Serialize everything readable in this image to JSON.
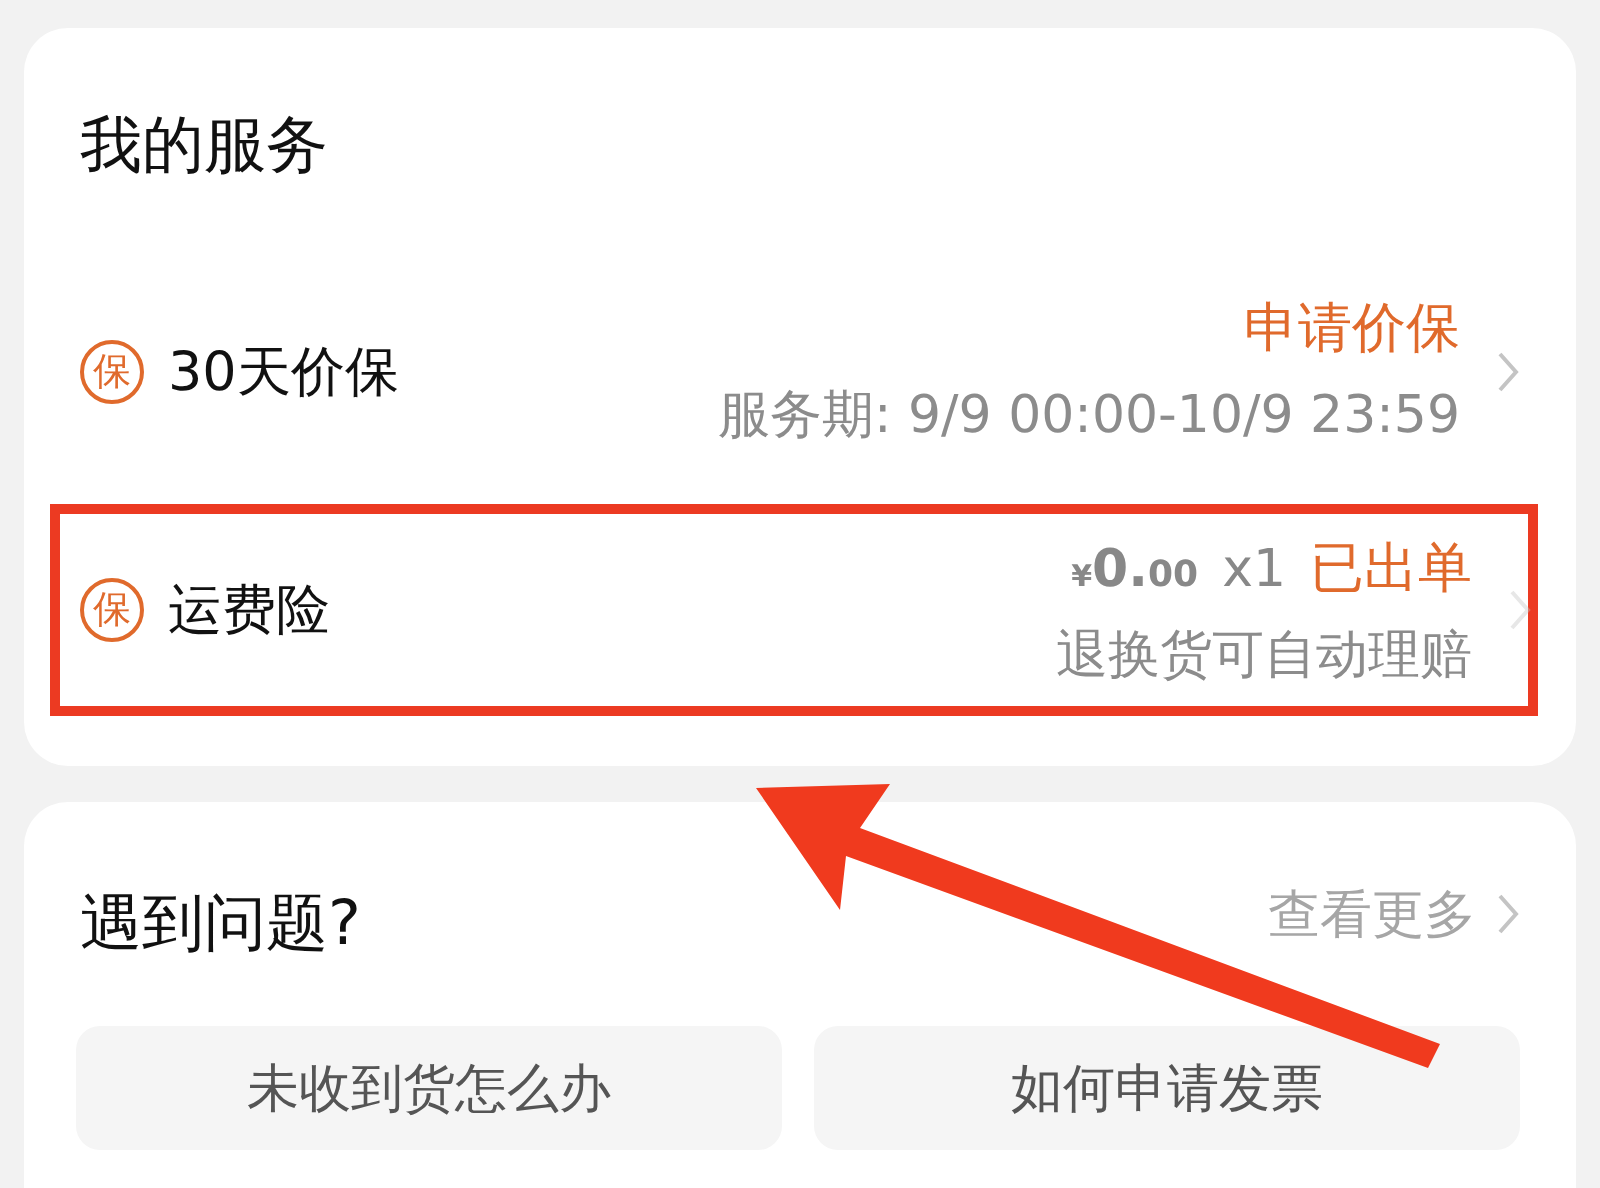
{
  "services": {
    "title": "我的服务",
    "items": [
      {
        "icon": "保",
        "name": "30天价保",
        "action": "申请价保",
        "detail": "服务期: 9/9 00:00-10/9 23:59",
        "highlighted": false
      },
      {
        "icon": "保",
        "name": "运费险",
        "currency": "¥",
        "price_int": "0.",
        "price_dec": "00",
        "quantity": "x1",
        "action": "已出单",
        "detail": "退换货可自动理赔",
        "highlighted": true
      }
    ]
  },
  "problems": {
    "title": "遇到问题?",
    "more": "查看更多",
    "questions": [
      "未收到货怎么办",
      "如何申请发票"
    ]
  }
}
